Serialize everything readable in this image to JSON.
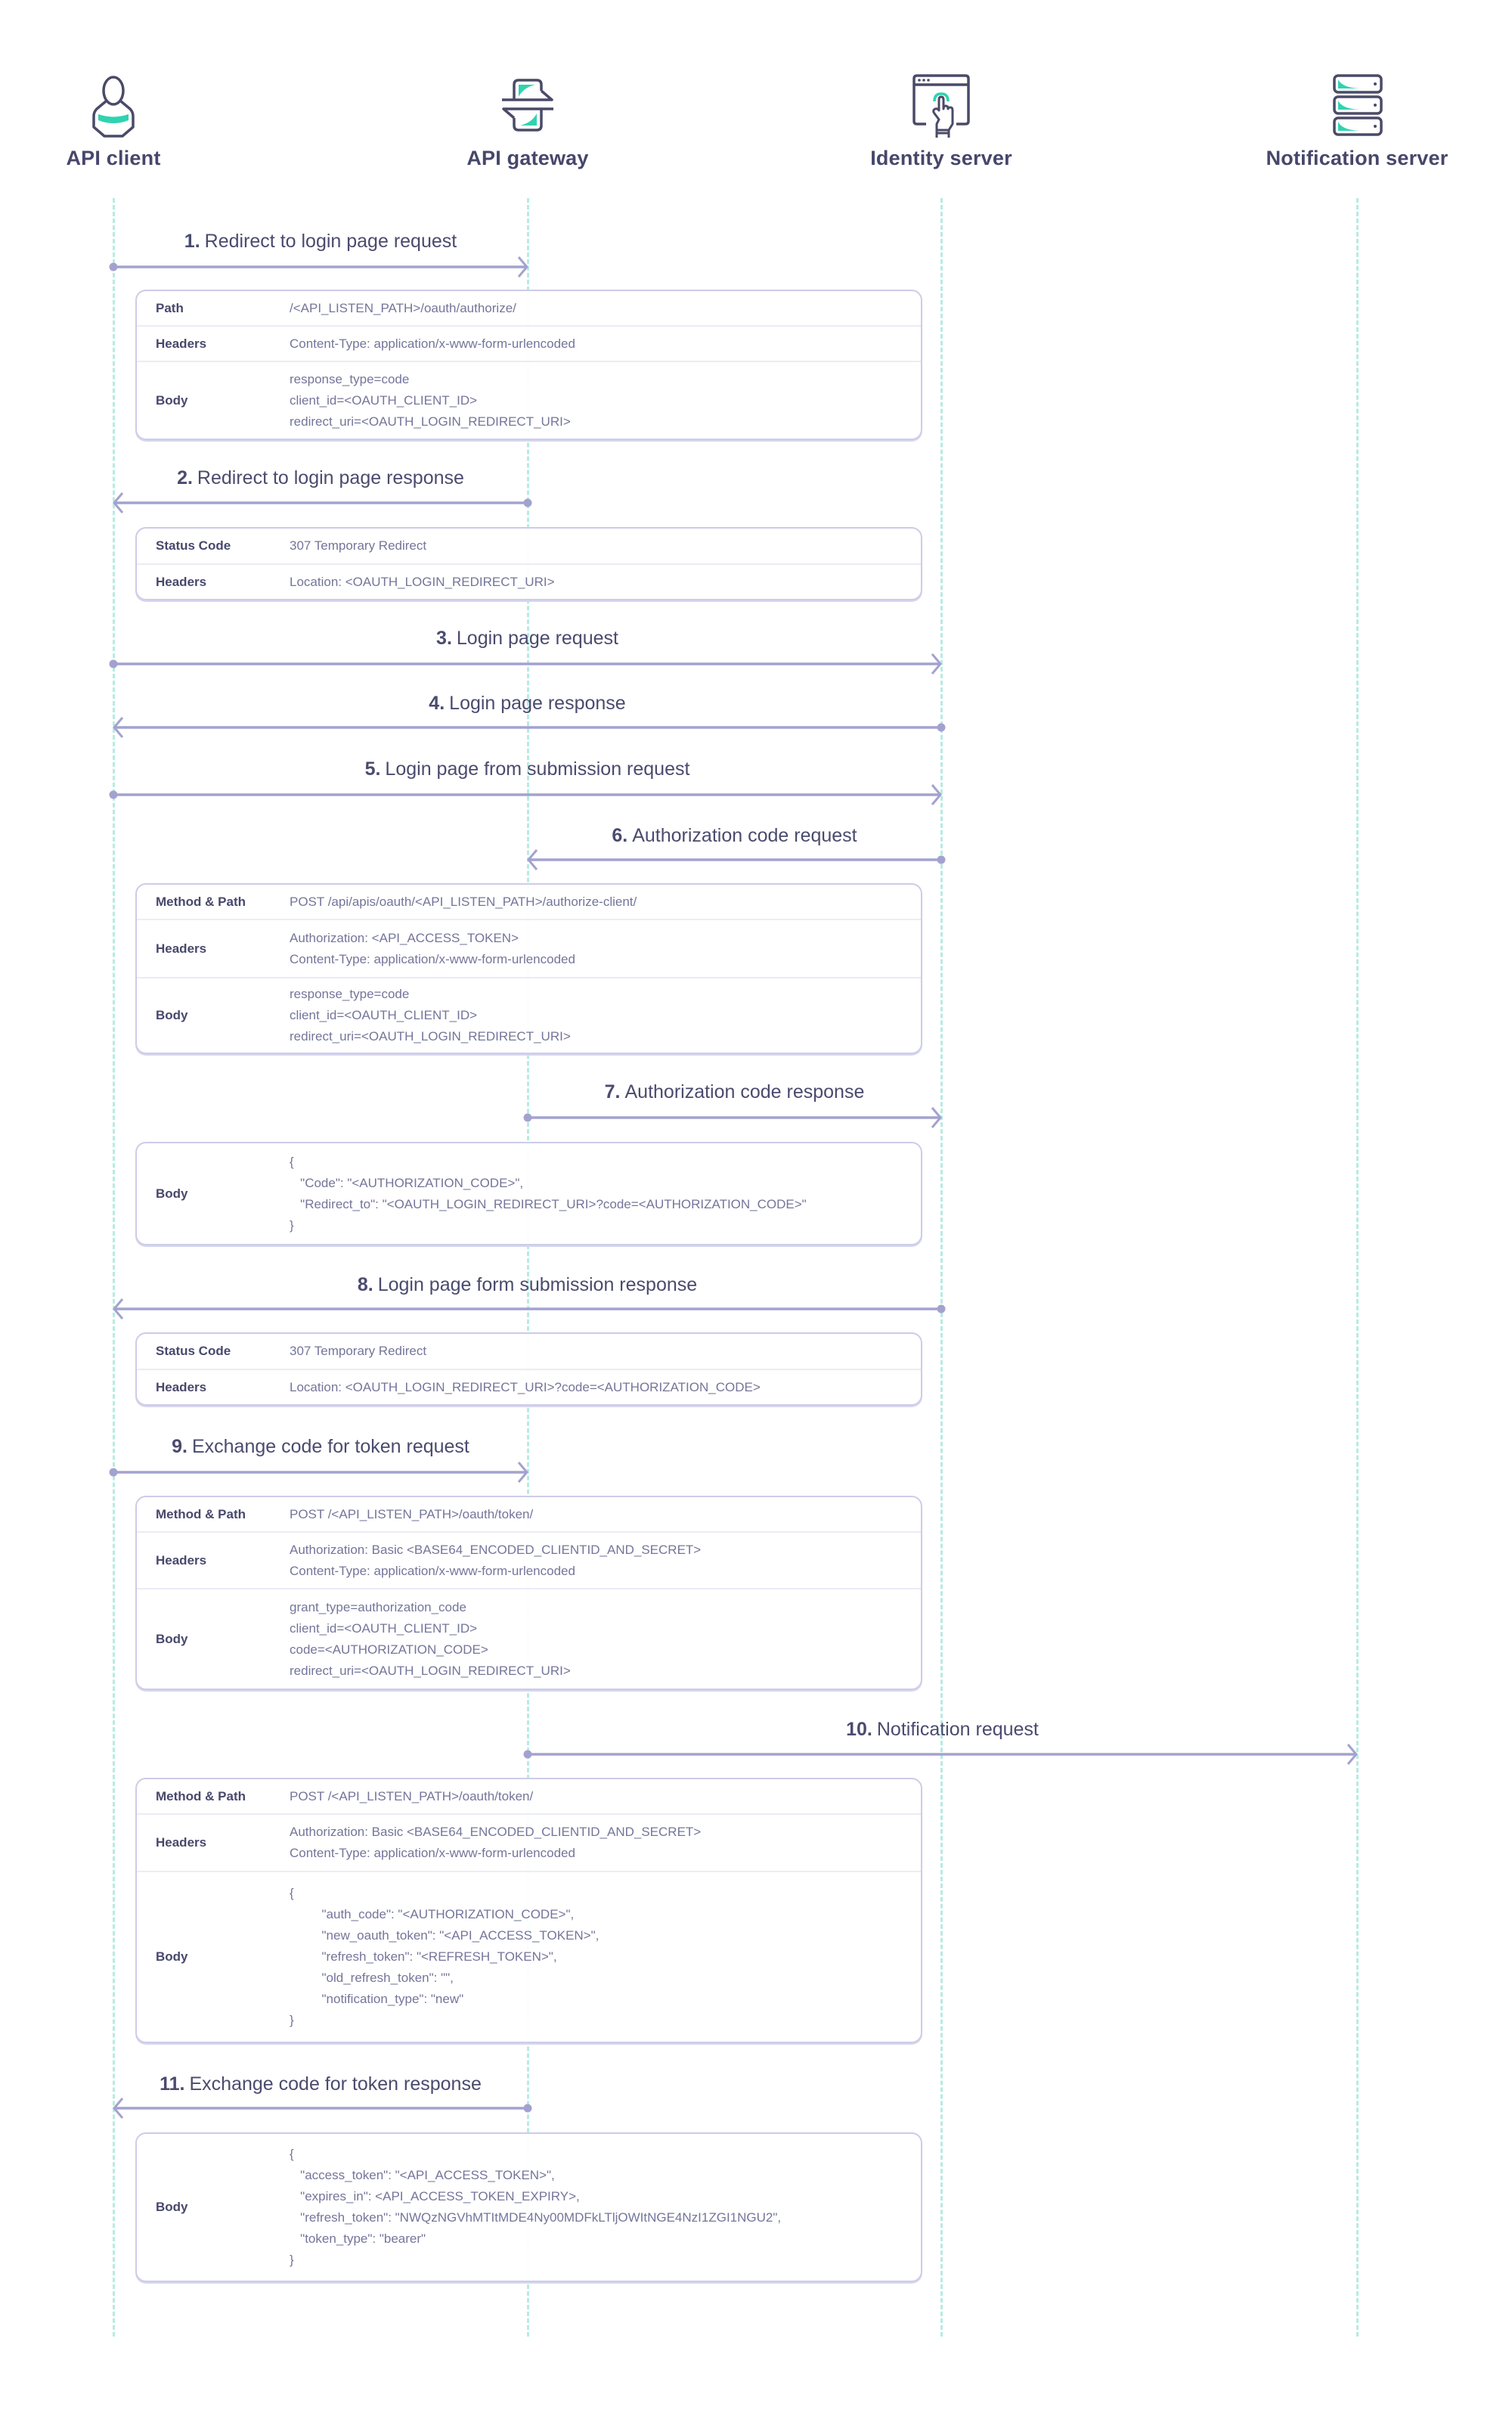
{
  "diagram": {
    "type": "sequence",
    "colors": {
      "lifeline": "#b5ece2",
      "arrow": "#a3a2cf",
      "text_dark": "#46476b",
      "text_value": "#74759a",
      "box_border": "#cdcce8",
      "icon_accent": "#2fd3b0",
      "icon_stroke": "#4a4a68"
    },
    "participants": [
      {
        "id": "client",
        "name": "API client",
        "icon": "user-icon"
      },
      {
        "id": "gateway",
        "name": "API gateway",
        "icon": "exchange-icon"
      },
      {
        "id": "identity",
        "name": "Identity server",
        "icon": "browser-touch-icon"
      },
      {
        "id": "notification",
        "name": "Notification server",
        "icon": "server-stack-icon"
      }
    ],
    "messages": [
      {
        "num": "1.",
        "label": "Redirect to login page request",
        "from": "client",
        "to": "gateway",
        "details": [
          {
            "label": "Path",
            "lines": [
              "/<API_LISTEN_PATH>/oauth/authorize/"
            ]
          },
          {
            "label": "Headers",
            "lines": [
              "Content-Type: application/x-www-form-urlencoded"
            ]
          },
          {
            "label": "Body",
            "lines": [
              "response_type=code",
              "client_id=<OAUTH_CLIENT_ID>",
              "redirect_uri=<OAUTH_LOGIN_REDIRECT_URI>"
            ]
          }
        ]
      },
      {
        "num": "2.",
        "label": "Redirect to login page response",
        "from": "gateway",
        "to": "client",
        "details": [
          {
            "label": "Status Code",
            "lines": [
              "307 Temporary Redirect"
            ]
          },
          {
            "label": "Headers",
            "lines": [
              "Location: <OAUTH_LOGIN_REDIRECT_URI>"
            ]
          }
        ]
      },
      {
        "num": "3.",
        "label": "Login page request",
        "from": "client",
        "to": "identity",
        "details": []
      },
      {
        "num": "4.",
        "label": "Login page response",
        "from": "identity",
        "to": "client",
        "details": []
      },
      {
        "num": "5.",
        "label": "Login page from submission request",
        "from": "client",
        "to": "identity",
        "details": []
      },
      {
        "num": "6.",
        "label": "Authorization code request",
        "from": "identity",
        "to": "gateway",
        "details": [
          {
            "label": "Method & Path",
            "lines": [
              "POST /api/apis/oauth/<API_LISTEN_PATH>/authorize-client/"
            ]
          },
          {
            "label": "Headers",
            "lines": [
              "Authorization: <API_ACCESS_TOKEN>",
              "Content-Type: application/x-www-form-urlencoded"
            ]
          },
          {
            "label": "Body",
            "lines": [
              "response_type=code",
              "client_id=<OAUTH_CLIENT_ID>",
              "redirect_uri=<OAUTH_LOGIN_REDIRECT_URI>"
            ]
          }
        ]
      },
      {
        "num": "7.",
        "label": "Authorization code response",
        "from": "gateway",
        "to": "identity",
        "details": [
          {
            "label": "Body",
            "lines": [
              "{",
              "   \"Code\": \"<AUTHORIZATION_CODE>\",",
              "   \"Redirect_to\": \"<OAUTH_LOGIN_REDIRECT_URI>?code=<AUTHORIZATION_CODE>\"",
              "}"
            ]
          }
        ]
      },
      {
        "num": "8.",
        "label": "Login page form submission response",
        "from": "identity",
        "to": "client",
        "details": [
          {
            "label": "Status Code",
            "lines": [
              "307 Temporary Redirect"
            ]
          },
          {
            "label": "Headers",
            "lines": [
              "Location: <OAUTH_LOGIN_REDIRECT_URI>?code=<AUTHORIZATION_CODE>"
            ]
          }
        ]
      },
      {
        "num": "9.",
        "label": "Exchange code for token request",
        "from": "client",
        "to": "gateway",
        "details": [
          {
            "label": "Method & Path",
            "lines": [
              "POST /<API_LISTEN_PATH>/oauth/token/"
            ]
          },
          {
            "label": "Headers",
            "lines": [
              "Authorization: Basic <BASE64_ENCODED_CLIENTID_AND_SECRET>",
              "Content-Type: application/x-www-form-urlencoded"
            ]
          },
          {
            "label": "Body",
            "lines": [
              "grant_type=authorization_code",
              "client_id=<OAUTH_CLIENT_ID>",
              "code=<AUTHORIZATION_CODE>",
              "redirect_uri=<OAUTH_LOGIN_REDIRECT_URI>"
            ]
          }
        ]
      },
      {
        "num": "10.",
        "label": "Notification request",
        "from": "gateway",
        "to": "notification",
        "details": [
          {
            "label": "Method & Path",
            "lines": [
              "POST /<API_LISTEN_PATH>/oauth/token/"
            ]
          },
          {
            "label": "Headers",
            "lines": [
              "Authorization: Basic <BASE64_ENCODED_CLIENTID_AND_SECRET>",
              "Content-Type: application/x-www-form-urlencoded"
            ]
          },
          {
            "label": "Body",
            "lines": [
              "{",
              "         \"auth_code\": \"<AUTHORIZATION_CODE>\",",
              "         \"new_oauth_token\": \"<API_ACCESS_TOKEN>\",",
              "         \"refresh_token\": \"<REFRESH_TOKEN>\",",
              "         \"old_refresh_token\": \"\",",
              "         \"notification_type\": \"new\"",
              "}"
            ]
          }
        ]
      },
      {
        "num": "11.",
        "label": "Exchange code for token response",
        "from": "gateway",
        "to": "client",
        "details": [
          {
            "label": "Body",
            "lines": [
              "{",
              "   \"access_token\": \"<API_ACCESS_TOKEN>\",",
              "   \"expires_in\": <API_ACCESS_TOKEN_EXPIRY>,",
              "   \"refresh_token\": \"NWQzNGVhMTItMDE4Ny00MDFkLTljOWItNGE4NzI1ZGI1NGU2\",",
              "   \"token_type\": \"bearer\"",
              "}"
            ]
          }
        ]
      }
    ]
  }
}
